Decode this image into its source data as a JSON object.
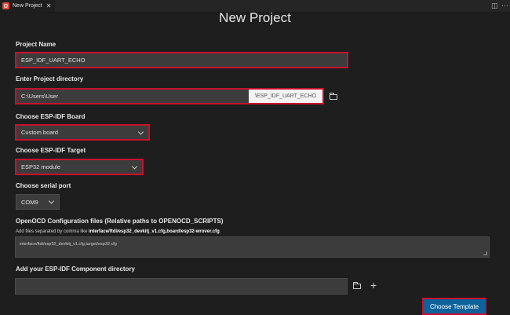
{
  "tab": {
    "title": "New Project",
    "close": "✕"
  },
  "top_icons": {
    "split": "◫",
    "more": "⋯"
  },
  "title": "New Project",
  "project_name": {
    "label": "Project Name",
    "value": "ESP_IDF_UART_ECHO"
  },
  "project_directory": {
    "label": "Enter Project directory",
    "value": "C:\\Users\\User",
    "suffix": "\\ESP_IDF_UART_ECHO"
  },
  "board": {
    "label": "Choose ESP-IDF Board",
    "value": "Custom board"
  },
  "target": {
    "label": "Choose ESP-IDF Target",
    "value": "ESP32 module"
  },
  "serial_port": {
    "label": "Choose serial port",
    "value": "COM9"
  },
  "openocd": {
    "label": "OpenOCD Configuration files (Relative paths to OPENOCD_SCRIPTS)",
    "hint_prefix": "Add files separated by comma like ",
    "hint_example": "interface/ftdi/esp32_devkitj_v1.cfg,board/esp32-wrover.cfg",
    "value": "interface/ftdi/esp32_devkitj_v1.cfg,target/esp32.cfg"
  },
  "component_directory": {
    "label": "Add your ESP-IDF Component directory",
    "value": ""
  },
  "choose_template_button": "Choose Template",
  "colors": {
    "accent": "#0e639c",
    "highlight": "#c8102e",
    "background": "#1e1e1e",
    "input": "#3c3c3c"
  }
}
